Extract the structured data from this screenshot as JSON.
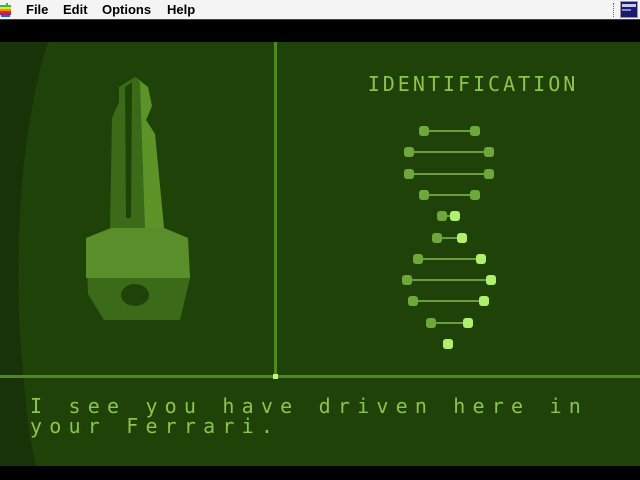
{
  "menubar": {
    "items": [
      "File",
      "Edit",
      "Options",
      "Help"
    ]
  },
  "game": {
    "panel_title": "IDENTIFICATION",
    "dialogue": "I see you have driven here in your Ferrari.",
    "colors": {
      "background": "#1f4209",
      "text": "#8ec24a",
      "divider": "#4d8a1a",
      "highlight": "#b0f06a"
    }
  },
  "icons": {
    "apple": "apple-rainbow-logo",
    "key": "car-key",
    "helix": "dna-helix"
  }
}
